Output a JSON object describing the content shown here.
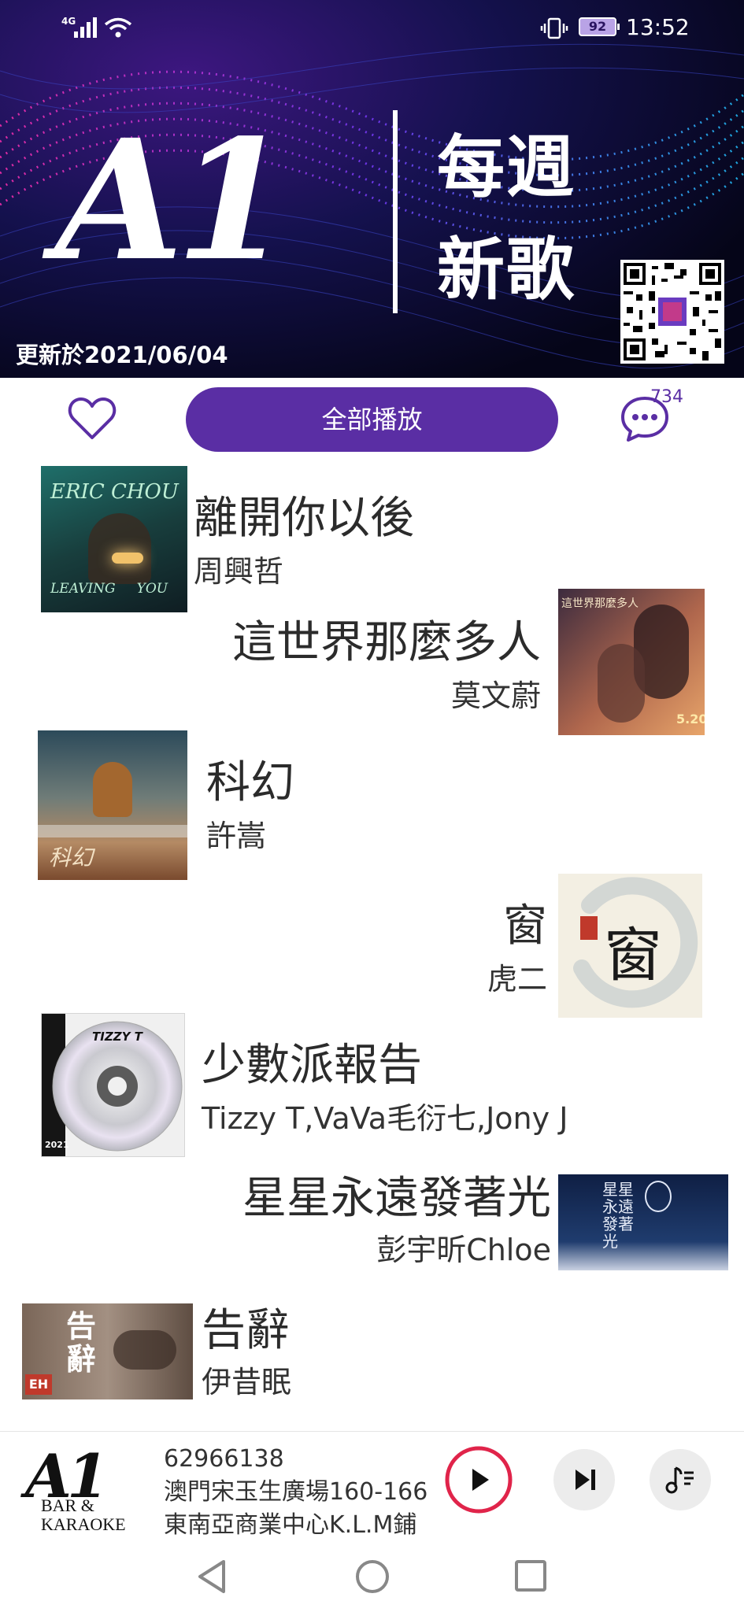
{
  "status_bar": {
    "network": "4G",
    "battery": "92",
    "time": "13:52"
  },
  "banner": {
    "logo": "A1",
    "title_line1": "每週",
    "title_line2": "新歌",
    "updated": "更新於2021/06/04"
  },
  "actions": {
    "play_all": "全部播放",
    "comment_count": "734"
  },
  "songs": [
    {
      "title": "離開你以後",
      "artist": "周興哲",
      "cover_text_top": "ERIC CHOU",
      "cover_text_bottom": "LEAVING     YOU"
    },
    {
      "title": "這世界那麼多人",
      "artist": "莫文蔚",
      "cover_text_top": "這世界那麼多人",
      "cover_text_bottom": "5.20"
    },
    {
      "title": "科幻",
      "artist": "許嵩",
      "cover_text_top": "",
      "cover_text_bottom": "科幻"
    },
    {
      "title": "窗",
      "artist": "虎二",
      "cover_text_top": "窗",
      "cover_text_bottom": ""
    },
    {
      "title": "少數派報告",
      "artist": "Tizzy T,VaVa毛衍七,Jony J",
      "cover_text_top": "TIZZY T",
      "cover_text_bottom": "2021"
    },
    {
      "title": "星星永遠發著光",
      "artist": "彭宇昕Chloe",
      "cover_text_top": "星星永遠發著光",
      "cover_text_bottom": ""
    },
    {
      "title": "告辭",
      "artist": "伊昔眠",
      "cover_text_top": "告辭",
      "cover_text_bottom": "EH"
    }
  ],
  "player": {
    "logo_mark": "A1",
    "logo_line1": "BAR &",
    "logo_line2": "KARAOKE",
    "phone": "62966138",
    "address_line1": "澳門宋玉生廣場160-166",
    "address_line2": "東南亞商業中心K.L.M鋪"
  },
  "icons": {
    "favorite": "heart-outline-icon",
    "comments": "chat-bubble-icon",
    "play": "play-icon",
    "next": "skip-next-icon",
    "queue": "playlist-icon",
    "nav_back": "triangle-back-icon",
    "nav_home": "circle-home-icon",
    "nav_recent": "square-recent-icon"
  },
  "colors": {
    "accent": "#5a2ea4",
    "play_ring": "#e0244a",
    "banner_bg": "#0a0a2e"
  }
}
